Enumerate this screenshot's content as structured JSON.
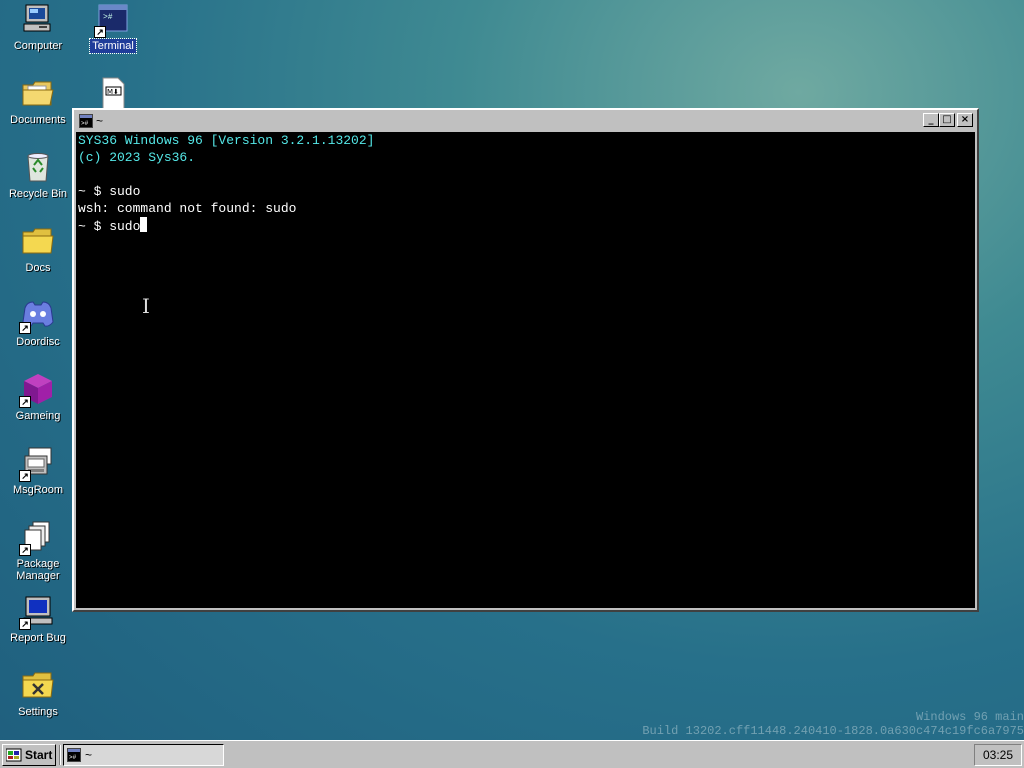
{
  "desktop": {
    "icons": [
      {
        "label": "Computer"
      },
      {
        "label": "Terminal"
      },
      {
        "label": "Documents"
      },
      {
        "label": "Recycle Bin"
      },
      {
        "label": "Docs"
      },
      {
        "label": "Doordisc"
      },
      {
        "label": "Gameing"
      },
      {
        "label": "MsgRoom"
      },
      {
        "label": "Package Manager"
      },
      {
        "label": "Report Bug"
      },
      {
        "label": "Settings"
      }
    ],
    "file_icon_badge": "M⬇"
  },
  "terminal": {
    "title": "~",
    "buttons": {
      "minimize": "_",
      "maximize": "□",
      "close": "×"
    },
    "lines": [
      "SYS36 Windows 96 [Version 3.2.1.13202]",
      "(c) 2023 Sys36.",
      "",
      "~ $ sudo",
      "wsh: command not found: sudo",
      "~ $ sudo"
    ],
    "ibeam": "I",
    "header_color": "#55e8e8"
  },
  "watermark": {
    "line1": "Windows 96 main",
    "line2": "Build 13202.cff11448.240410-1828.0a630c474c19fc6a7975"
  },
  "taskbar": {
    "start_label": "Start",
    "task_title": "~",
    "clock": "03:25"
  }
}
